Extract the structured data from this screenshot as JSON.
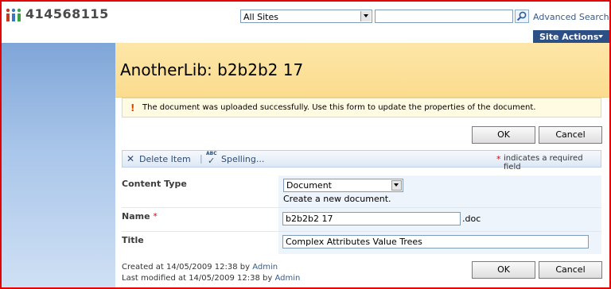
{
  "header": {
    "site_title": "414568115",
    "scope_value": "All Sites",
    "search_value": "",
    "advanced_search": "Advanced Search",
    "site_actions": "Site Actions"
  },
  "page": {
    "title": "AnotherLib: b2b2b2 17"
  },
  "message": {
    "text": "The document was uploaded successfully. Use this form to update the properties of the document."
  },
  "buttons": {
    "ok": "OK",
    "cancel": "Cancel"
  },
  "toolbar": {
    "delete_item": "Delete Item",
    "spelling": "Spelling...",
    "required_note": "indicates a required field",
    "required_star": "*",
    "abc": "ABC"
  },
  "form": {
    "content_type_label": "Content Type",
    "content_type_value": "Document",
    "content_type_desc": "Create a new document.",
    "name_label": "Name",
    "name_required": "*",
    "name_value": "b2b2b2 17",
    "name_ext": ".doc",
    "title_label": "Title",
    "title_value": "Complex Attributes Value Trees"
  },
  "footer": {
    "created_prefix": "Created at 14/05/2009 12:38  by",
    "created_by": "Admin",
    "modified_prefix": "Last modified at 14/05/2009 12:38  by",
    "modified_by": "Admin"
  },
  "colors": {
    "accent": "#2c4f86",
    "title_band": "#fcdc8e",
    "frame": "#e20000"
  }
}
